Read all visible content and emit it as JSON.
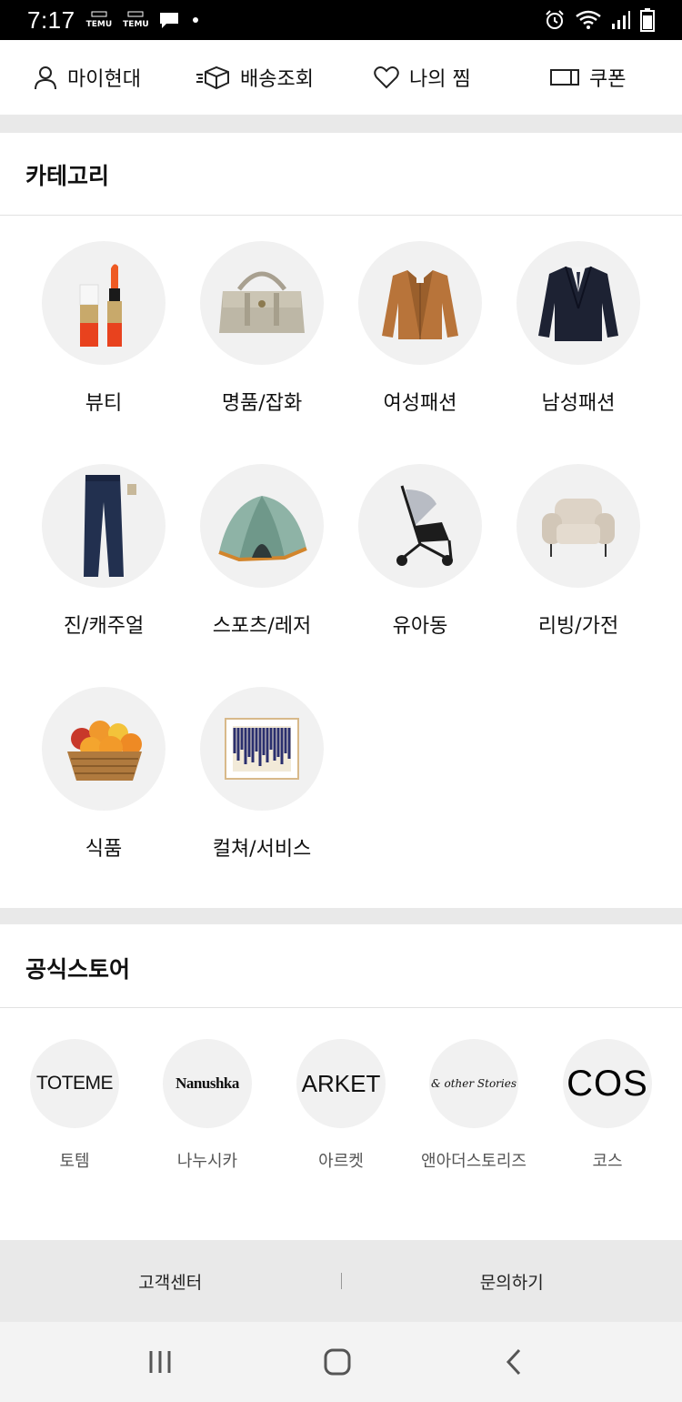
{
  "status_bar": {
    "time": "7:17",
    "apps": [
      "TEMU",
      "TEMU"
    ]
  },
  "quick_menu": [
    {
      "label": "마이현대",
      "icon": "person-icon"
    },
    {
      "label": "배송조회",
      "icon": "delivery-box-icon"
    },
    {
      "label": "나의 찜",
      "icon": "heart-icon"
    },
    {
      "label": "쿠폰",
      "icon": "coupon-icon"
    }
  ],
  "category": {
    "title": "카테고리",
    "items": [
      {
        "label": "뷰티",
        "icon": "lipstick-icon"
      },
      {
        "label": "명품/잡화",
        "icon": "handbag-icon"
      },
      {
        "label": "여성패션",
        "icon": "womens-jacket-icon"
      },
      {
        "label": "남성패션",
        "icon": "mens-suit-icon"
      },
      {
        "label": "진/캐주얼",
        "icon": "jeans-icon"
      },
      {
        "label": "스포츠/레저",
        "icon": "tent-icon"
      },
      {
        "label": "유아동",
        "icon": "stroller-icon"
      },
      {
        "label": "리빙/가전",
        "icon": "armchair-icon"
      },
      {
        "label": "식품",
        "icon": "fruit-basket-icon"
      },
      {
        "label": "컬쳐/서비스",
        "icon": "framed-art-icon"
      }
    ]
  },
  "official_store": {
    "title": "공식스토어",
    "items": [
      {
        "logo": "TOTEME",
        "label": "토템"
      },
      {
        "logo": "Nanushka",
        "label": "나누시카"
      },
      {
        "logo": "ARKET",
        "label": "아르켓"
      },
      {
        "logo": "& other Stories",
        "label": "앤아더스토리즈"
      },
      {
        "logo": "COS",
        "label": "코스"
      }
    ]
  },
  "footer": {
    "customer_center": "고객센터",
    "inquiry": "문의하기"
  },
  "colors": {
    "background": "#ffffff",
    "section_gap": "#e9e9e9",
    "circle_bg": "#f1f1f1",
    "status_bar": "#000000"
  }
}
